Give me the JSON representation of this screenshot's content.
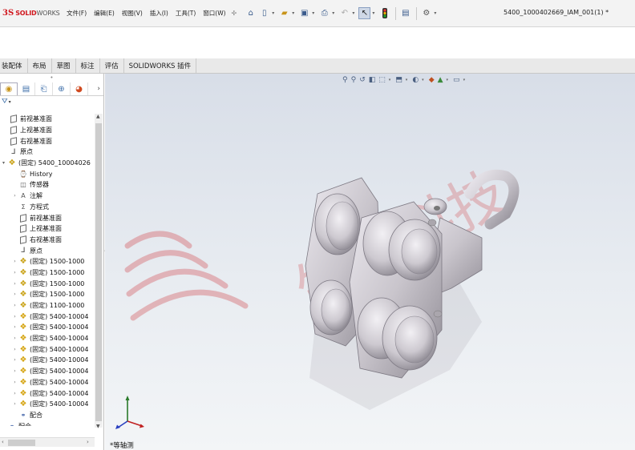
{
  "app": {
    "logo_ds": "3S",
    "logo_solid": "SOLID",
    "logo_works": "WORKS",
    "document_title": "5400_1000402669_IAM_001(1) *"
  },
  "menu": [
    "文件(F)",
    "编辑(E)",
    "视图(V)",
    "插入(I)",
    "工具(T)",
    "窗口(W)"
  ],
  "quick_access_icons": [
    "home-icon",
    "new-document-icon",
    "open-folder-icon",
    "save-icon",
    "print-icon",
    "undo-icon",
    "select-cursor-icon",
    "traffic-light-icon",
    "file-properties-icon",
    "options-gear-icon"
  ],
  "tabs": [
    "装配体",
    "布局",
    "草图",
    "标注",
    "评估",
    "SOLIDWORKS 插件"
  ],
  "panel_tabs": [
    "feature-manager-icon",
    "property-manager-icon",
    "configuration-manager-icon",
    "dimxpert-icon",
    "display-manager-icon"
  ],
  "tree": [
    {
      "label": "前视基准面",
      "icon": "plane",
      "level": 1,
      "expand": ""
    },
    {
      "label": "上视基准面",
      "icon": "plane",
      "level": 1,
      "expand": ""
    },
    {
      "label": "右视基准面",
      "icon": "plane",
      "level": 1,
      "expand": ""
    },
    {
      "label": "原点",
      "icon": "origin",
      "level": 1,
      "expand": ""
    },
    {
      "label": "(固定) 5400_10004026",
      "icon": "asm",
      "level": 0,
      "expand": "▾"
    },
    {
      "label": "History",
      "icon": "history",
      "level": 2,
      "expand": ""
    },
    {
      "label": "传感器",
      "icon": "sensor",
      "level": 2,
      "expand": ""
    },
    {
      "label": "注解",
      "icon": "annotation",
      "level": 2,
      "expand": "›"
    },
    {
      "label": "方程式",
      "icon": "equation",
      "level": 2,
      "expand": ""
    },
    {
      "label": "前视基准面",
      "icon": "plane",
      "level": 2,
      "expand": ""
    },
    {
      "label": "上视基准面",
      "icon": "plane",
      "level": 2,
      "expand": ""
    },
    {
      "label": "右视基准面",
      "icon": "plane",
      "level": 2,
      "expand": ""
    },
    {
      "label": "原点",
      "icon": "origin",
      "level": 2,
      "expand": ""
    },
    {
      "label": "(固定) 1500-1000",
      "icon": "asm",
      "level": 2,
      "expand": "›"
    },
    {
      "label": "(固定) 1500-1000",
      "icon": "asm",
      "level": 2,
      "expand": "›"
    },
    {
      "label": "(固定) 1500-1000",
      "icon": "asm",
      "level": 2,
      "expand": "›"
    },
    {
      "label": "(固定) 1500-1000",
      "icon": "asm",
      "level": 2,
      "expand": "›"
    },
    {
      "label": "(固定) 1100-1000",
      "icon": "asm",
      "level": 2,
      "expand": "›"
    },
    {
      "label": "(固定) 5400-10004",
      "icon": "part",
      "level": 2,
      "expand": "›"
    },
    {
      "label": "(固定) 5400-10004",
      "icon": "part",
      "level": 2,
      "expand": "›"
    },
    {
      "label": "(固定) 5400-10004",
      "icon": "part",
      "level": 2,
      "expand": "›"
    },
    {
      "label": "(固定) 5400-10004",
      "icon": "part",
      "level": 2,
      "expand": "›"
    },
    {
      "label": "(固定) 5400-10004",
      "icon": "part",
      "level": 2,
      "expand": "›"
    },
    {
      "label": "(固定) 5400-10004",
      "icon": "part",
      "level": 2,
      "expand": "›"
    },
    {
      "label": "(固定) 5400-10004",
      "icon": "part",
      "level": 2,
      "expand": "›"
    },
    {
      "label": "(固定) 5400-10004",
      "icon": "part",
      "level": 2,
      "expand": "›"
    },
    {
      "label": "(固定) 5400-10004",
      "icon": "part",
      "level": 2,
      "expand": "›"
    },
    {
      "label": "配合",
      "icon": "mate",
      "level": 2,
      "expand": ""
    },
    {
      "label": "配合",
      "icon": "mate",
      "level": 0,
      "expand": ""
    }
  ],
  "viewport": {
    "view_label": "*等轴测",
    "watermark": "生信科技",
    "hud_icons": [
      "zoom-to-fit-icon",
      "zoom-area-icon",
      "previous-view-icon",
      "section-view-icon",
      "dynamic-annotation-icon",
      "view-orientation-icon",
      "display-style-icon",
      "hide-show-icon",
      "edit-appearance-icon",
      "apply-scene-icon",
      "view-settings-icon"
    ],
    "colors": {
      "part_metal": "#c9c5cc",
      "part_shadow": "#8e8a93",
      "watermark": "#d2484c",
      "bg_top": "#d8dee8",
      "bg_bottom": "#f3f5f7"
    }
  }
}
